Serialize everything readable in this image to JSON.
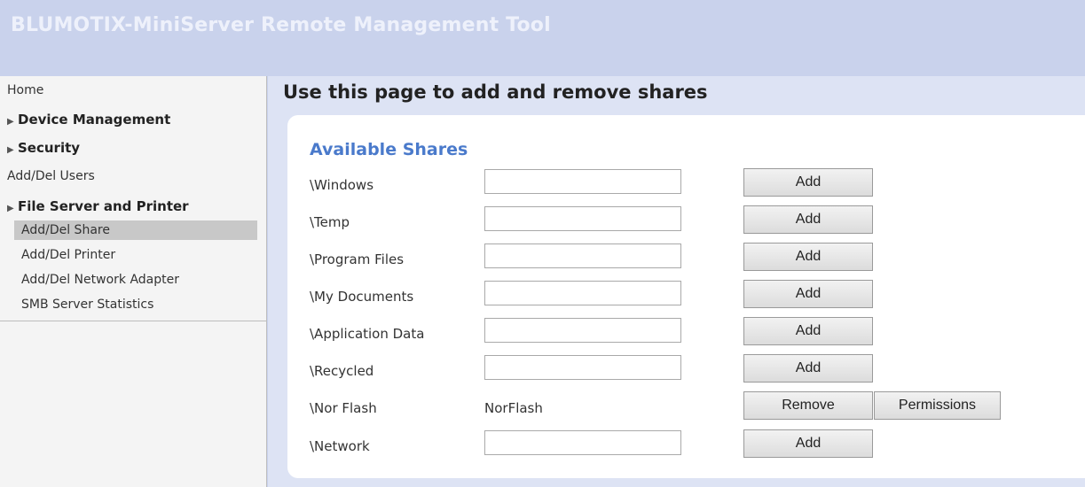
{
  "header": {
    "title": "BLUMOTIX-MiniServer Remote Management Tool"
  },
  "sidebar": {
    "home": "Home",
    "device_management": "Device Management",
    "security": "Security",
    "add_del_users": "Add/Del Users",
    "file_server_printer": "File Server and Printer",
    "sub_items": [
      "Add/Del Share",
      "Add/Del Printer",
      "Add/Del Network Adapter",
      "SMB Server Statistics"
    ]
  },
  "main": {
    "page_title": "Use this page to add and remove shares",
    "panel_title": "Available Shares",
    "shares": [
      {
        "name": "\\Windows",
        "input": "",
        "button": "Add"
      },
      {
        "name": "\\Temp",
        "input": "",
        "button": "Add"
      },
      {
        "name": "\\Program Files",
        "input": "",
        "button": "Add"
      },
      {
        "name": "\\My Documents",
        "input": "",
        "button": "Add"
      },
      {
        "name": "\\Application Data",
        "input": "",
        "button": "Add"
      },
      {
        "name": "\\Recycled",
        "input": "",
        "button": "Add"
      },
      {
        "name": "\\Nor Flash",
        "value": "NorFlash",
        "button": "Remove",
        "button2": "Permissions"
      },
      {
        "name": "\\Network",
        "input": "",
        "button": "Add"
      }
    ]
  }
}
